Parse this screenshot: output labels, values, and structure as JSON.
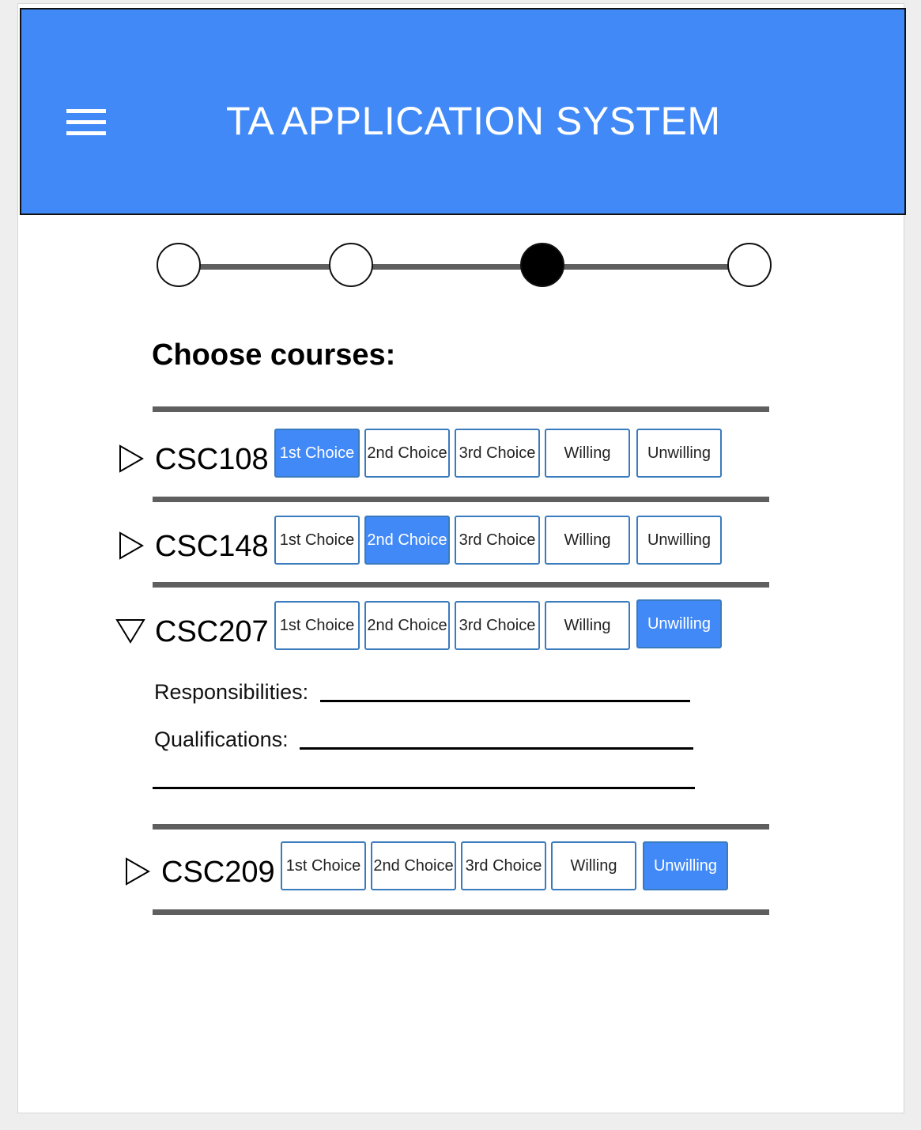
{
  "header": {
    "title": "TA APPLICATION SYSTEM",
    "menu_icon": "hamburger-menu-icon"
  },
  "stepper": {
    "total_steps": 4,
    "current_step": 3
  },
  "section": {
    "title": "Choose courses:"
  },
  "choice_labels": [
    "1st Choice",
    "2nd Choice",
    "3rd Choice",
    "Willing",
    "Unwilling"
  ],
  "courses": [
    {
      "code": "CSC108",
      "expanded": false,
      "selected": "1st Choice"
    },
    {
      "code": "CSC148",
      "expanded": false,
      "selected": "2nd Choice"
    },
    {
      "code": "CSC207",
      "expanded": true,
      "selected": "Unwilling",
      "details": {
        "responsibilities_label": "Responsibilities:",
        "qualifications_label": "Qualifications:",
        "responsibilities_value": "",
        "qualifications_value": ""
      }
    },
    {
      "code": "CSC209",
      "expanded": false,
      "selected": "Unwilling"
    }
  ],
  "colors": {
    "header_bg": "#4189f7",
    "selected_bg": "#4189f7",
    "button_border": "#3a7bbe",
    "divider": "#5f5f5f"
  }
}
